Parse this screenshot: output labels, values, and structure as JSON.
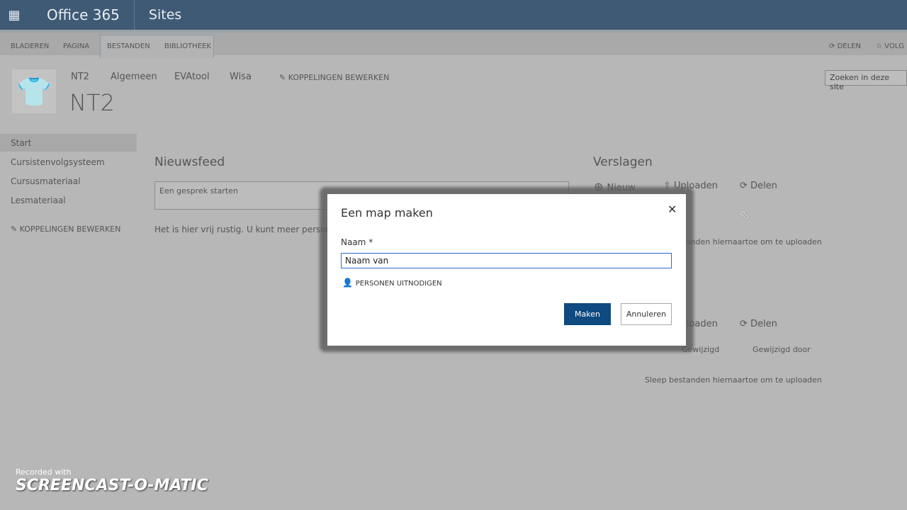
{
  "topbar": {
    "brand": "Office 365",
    "app": "Sites"
  },
  "ribbon": {
    "tabs": [
      "BLADEREN",
      "PAGINA",
      "BESTANDEN",
      "BIBLIOTHEEK"
    ],
    "share": "DELEN",
    "follow": "VOLG"
  },
  "site": {
    "title": "NT2",
    "nav": [
      "NT2",
      "Algemeen",
      "EVAtool",
      "Wisa"
    ],
    "edit_links": "KOPPELINGEN BEWERKEN",
    "search_placeholder": "Zoeken in deze site"
  },
  "left_nav": {
    "items": [
      "Start",
      "Cursistenvolgsysteem",
      "Cursusmateriaal",
      "Lesmateriaal"
    ],
    "edit_links": "KOPPELINGEN BEWERKEN"
  },
  "newsfeed": {
    "title": "Nieuwsfeed",
    "placeholder": "Een gesprek starten",
    "empty": "Het is hier vrij rustig. U kunt meer personen volgen"
  },
  "reports": {
    "title": "Verslagen",
    "new": "Nieuw",
    "upload": "Uploaden",
    "share": "Delen",
    "drop": "Sleep bestanden hiernaartoe om te uploaden",
    "col_modified": "Gewijzigd",
    "col_modified_by": "Gewijzigd door",
    "drop2": "Sleep bestanden hiernaartoe om te uploaden"
  },
  "dialog": {
    "title": "Een map maken",
    "name_label": "Naam *",
    "name_value": "Naam van",
    "invite": "PERSONEN UITNODIGEN",
    "make": "Maken",
    "cancel": "Annuleren"
  },
  "watermark": {
    "line1": "Recorded with",
    "line2": "SCREENCAST-O-MATIC"
  }
}
